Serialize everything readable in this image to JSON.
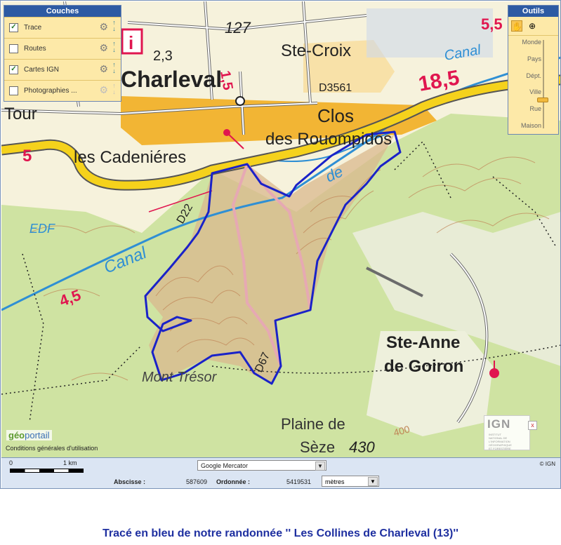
{
  "layers_panel": {
    "title": "Couches",
    "items": [
      {
        "label": "Trace",
        "checked": true,
        "gear_icon": "gear-icon",
        "order_icon": "up-down-arrows-icon"
      },
      {
        "label": "Routes",
        "checked": false,
        "gear_icon": "gear-icon",
        "order_icon": "up-down-arrows-icon"
      },
      {
        "label": "Cartes IGN",
        "checked": true,
        "gear_icon": "gear-icon",
        "order_icon": "up-down-arrows-icon"
      },
      {
        "label": "Photographies ...",
        "checked": false,
        "gear_icon": "gear-icon",
        "order_icon": "up-down-arrows-icon"
      }
    ]
  },
  "tools_panel": {
    "title": "Outils",
    "pan_icon": "hand-pan-icon",
    "zoom_icon": "zoom-box-icon",
    "zoom_levels": [
      "Monde",
      "Pays",
      "Dépt.",
      "Ville",
      "Rue",
      "Maison"
    ],
    "current_zoom": "Rue"
  },
  "map": {
    "labels": {
      "charleval": "Charleval",
      "tour": "Tour",
      "ste_croix": "Ste-Croix",
      "clos": "Clos",
      "roumpidos": "des Rouompidos",
      "cadenieres": "les Cadeniéres",
      "canal_1": "Canal",
      "canal_2": "Canal",
      "edf": "EDF",
      "de": "de",
      "d22": "D22",
      "d3561": "D3561",
      "d67": "D67",
      "mont_tresor": "Mont Trésor",
      "ste_anne": "Ste-Anne",
      "de_goiron": "de Goiron",
      "plaine_de": "Plaine de",
      "seze": "Sèze",
      "alt_430": "430",
      "alt_400": "400",
      "n127": "127",
      "n23": "2,3",
      "n15": "1,5",
      "n185": "18,5",
      "n55": "5,5",
      "n5": "5",
      "n45": "4,5",
      "info_i": "i"
    },
    "colors": {
      "trace": "#1a22c8",
      "road_yellow": "#f5d21c",
      "water": "#2f8fd4",
      "forest": "#c7dd95",
      "urban": "#f0b32c",
      "relief_brown": "#c9885a",
      "road_red": "#e0164f"
    }
  },
  "logos": {
    "geoportail_geo": "géo",
    "geoportail_portail": "portail",
    "conditions": "Conditions générales d'utilisation",
    "ign": "IGN",
    "ign_sub": "INSTITUT NATIONAL DE L'INFORMATION GÉOGRAPHIQUE ET FORESTIÈRE",
    "ign_close": "x"
  },
  "bottom_bar": {
    "scale_start": "0",
    "scale_end": "1 km",
    "projection": "Google Mercator",
    "copyright": "© IGN",
    "abscisse_label": "Abscisse :",
    "abscisse_value": "587609",
    "ordonnee_label": "Ordonnée :",
    "ordonnee_value": "5419531",
    "unit": "mètres"
  },
  "caption": "Tracé en bleu de notre randonnée '' Les Collines de Charleval (13)''"
}
